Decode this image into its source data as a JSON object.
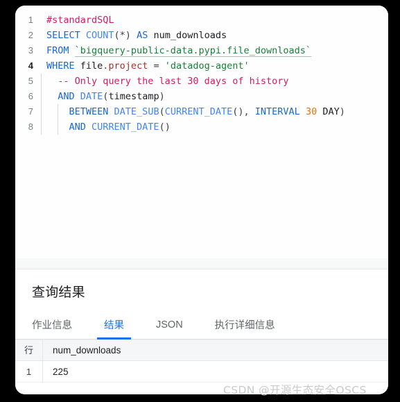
{
  "editor": {
    "lines": [
      {
        "number": "1",
        "active": false,
        "guides": 0,
        "tokens": [
          {
            "t": "#standardSQL",
            "c": "cmt"
          }
        ]
      },
      {
        "number": "2",
        "active": false,
        "guides": 0,
        "tokens": [
          {
            "t": "SELECT ",
            "c": "kw"
          },
          {
            "t": "COUNT",
            "c": "fn"
          },
          {
            "t": "(*) ",
            "c": "punc"
          },
          {
            "t": "AS ",
            "c": "kw"
          },
          {
            "t": "num_downloads",
            "c": "ident"
          }
        ]
      },
      {
        "number": "3",
        "active": false,
        "guides": 0,
        "tokens": [
          {
            "t": "FROM ",
            "c": "kw"
          },
          {
            "t": "`bigquery-public-data.pypi.file_downloads`",
            "c": "tbl"
          }
        ]
      },
      {
        "number": "4",
        "active": true,
        "guides": 0,
        "tokens": [
          {
            "t": "WHERE ",
            "c": "kw"
          },
          {
            "t": "file",
            "c": "ident"
          },
          {
            "t": ".project",
            "c": "prop"
          },
          {
            "t": " = ",
            "c": "punc"
          },
          {
            "t": "'datadog-agent'",
            "c": "str"
          }
        ]
      },
      {
        "number": "5",
        "active": false,
        "guides": 1,
        "tokens": [
          {
            "t": "  -- Only query the last 30 days of history",
            "c": "cmt"
          }
        ]
      },
      {
        "number": "6",
        "active": false,
        "guides": 1,
        "tokens": [
          {
            "t": "  AND ",
            "c": "kw"
          },
          {
            "t": "DATE",
            "c": "fn"
          },
          {
            "t": "(",
            "c": "punc"
          },
          {
            "t": "timestamp",
            "c": "ident"
          },
          {
            "t": ")",
            "c": "punc"
          }
        ]
      },
      {
        "number": "7",
        "active": false,
        "guides": 2,
        "tokens": [
          {
            "t": "    BETWEEN ",
            "c": "kw"
          },
          {
            "t": "DATE_SUB",
            "c": "fn"
          },
          {
            "t": "(",
            "c": "punc"
          },
          {
            "t": "CURRENT_DATE",
            "c": "fn"
          },
          {
            "t": "(), ",
            "c": "punc"
          },
          {
            "t": "INTERVAL ",
            "c": "kw"
          },
          {
            "t": "30",
            "c": "num"
          },
          {
            "t": " DAY",
            "c": "ident"
          },
          {
            "t": ")",
            "c": "punc"
          }
        ]
      },
      {
        "number": "8",
        "active": false,
        "guides": 2,
        "tokens": [
          {
            "t": "    AND ",
            "c": "kw"
          },
          {
            "t": "CURRENT_DATE",
            "c": "fn"
          },
          {
            "t": "()",
            "c": "punc"
          }
        ]
      }
    ]
  },
  "results": {
    "title": "查询结果",
    "tabs": [
      {
        "label": "作业信息",
        "active": false
      },
      {
        "label": "结果",
        "active": true
      },
      {
        "label": "JSON",
        "active": false
      },
      {
        "label": "执行详细信息",
        "active": false
      }
    ],
    "table": {
      "headers": [
        "行",
        "num_downloads"
      ],
      "rows": [
        {
          "index": "1",
          "values": [
            "225"
          ]
        }
      ]
    }
  },
  "watermark": "CSDN @开源生态安全OSCS",
  "colors": {
    "accent": "#1a73e8",
    "keyword": "#1967d2",
    "function": "#4285f4",
    "string": "#188038",
    "comment": "#d81b60",
    "number": "#e8710a",
    "property": "#a8322b"
  }
}
